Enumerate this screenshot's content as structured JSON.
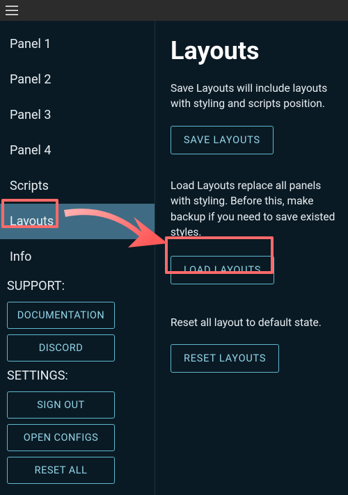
{
  "sidebar": {
    "items": [
      {
        "label": "Panel 1"
      },
      {
        "label": "Panel 2"
      },
      {
        "label": "Panel 3"
      },
      {
        "label": "Panel 4"
      },
      {
        "label": "Scripts"
      },
      {
        "label": "Layouts"
      },
      {
        "label": "Info"
      }
    ],
    "support_heading": "SUPPORT:",
    "support_buttons": [
      {
        "label": "DOCUMENTATION"
      },
      {
        "label": "DISCORD"
      }
    ],
    "settings_heading": "SETTINGS:",
    "settings_buttons": [
      {
        "label": "SIGN OUT"
      },
      {
        "label": "OPEN CONFIGS"
      },
      {
        "label": "RESET ALL"
      }
    ]
  },
  "content": {
    "title": "Layouts",
    "save": {
      "desc": "Save Layouts will include layouts with styling and scripts position.",
      "button": "SAVE LAYOUTS"
    },
    "load": {
      "desc": "Load Layouts replace all panels with styling. Before this, make backup if you need to save existed styles.",
      "button": "LOAD LAYOUTS"
    },
    "reset": {
      "desc": "Reset all layout to default state.",
      "button": "RESET LAYOUTS"
    }
  },
  "annotation": {
    "arrow_icon": "arrow-right",
    "highlight_color": "#ff6a6a"
  }
}
